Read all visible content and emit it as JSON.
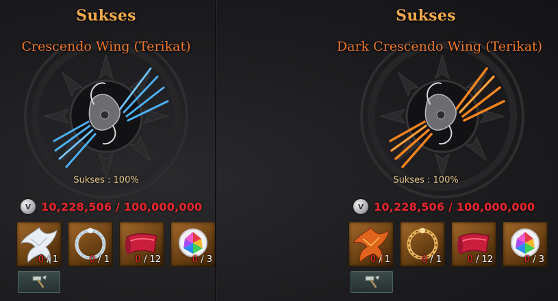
{
  "panels": [
    {
      "title": "Sukses",
      "item_name": "Crescendo Wing (Terikat)",
      "success_rate": "Sukses : 100%",
      "wing_color": "#4fb8ff",
      "currency": {
        "icon": "silver-coin-icon",
        "coin_symbol": "V",
        "value": "10,228,506 / 100,000,000"
      },
      "materials": [
        {
          "icon": "white-phoenix-icon",
          "have": "0",
          "need": " / 1"
        },
        {
          "icon": "silver-ring-icon",
          "have": "0",
          "need": " / 1"
        },
        {
          "icon": "red-scroll-icon",
          "have": "0",
          "need": " / 12"
        },
        {
          "icon": "prism-gem-icon",
          "have": "0",
          "need": " / 3"
        }
      ],
      "craft_button": {
        "icon": "hammer-icon"
      }
    },
    {
      "title": "Sukses",
      "item_name": "Dark Crescendo Wing (Terikat)",
      "success_rate": "Sukses : 100%",
      "wing_color": "#ff8a1e",
      "currency": {
        "icon": "silver-coin-icon",
        "coin_symbol": "V",
        "value": "10,228,506 / 100,000,000"
      },
      "materials": [
        {
          "icon": "fire-phoenix-icon",
          "have": "0",
          "need": " / 1"
        },
        {
          "icon": "gold-ring-icon",
          "have": "0",
          "need": " / 1"
        },
        {
          "icon": "red-scroll-icon",
          "have": "0",
          "need": " / 12"
        },
        {
          "icon": "prism-gem-icon",
          "have": "0",
          "need": " / 3"
        }
      ],
      "craft_button": {
        "icon": "hammer-icon"
      }
    }
  ],
  "colors": {
    "title": "#f3a94a",
    "item_name": "#f07a2c",
    "currency_value": "#e8282c",
    "count_have": "#ff2a2a"
  }
}
